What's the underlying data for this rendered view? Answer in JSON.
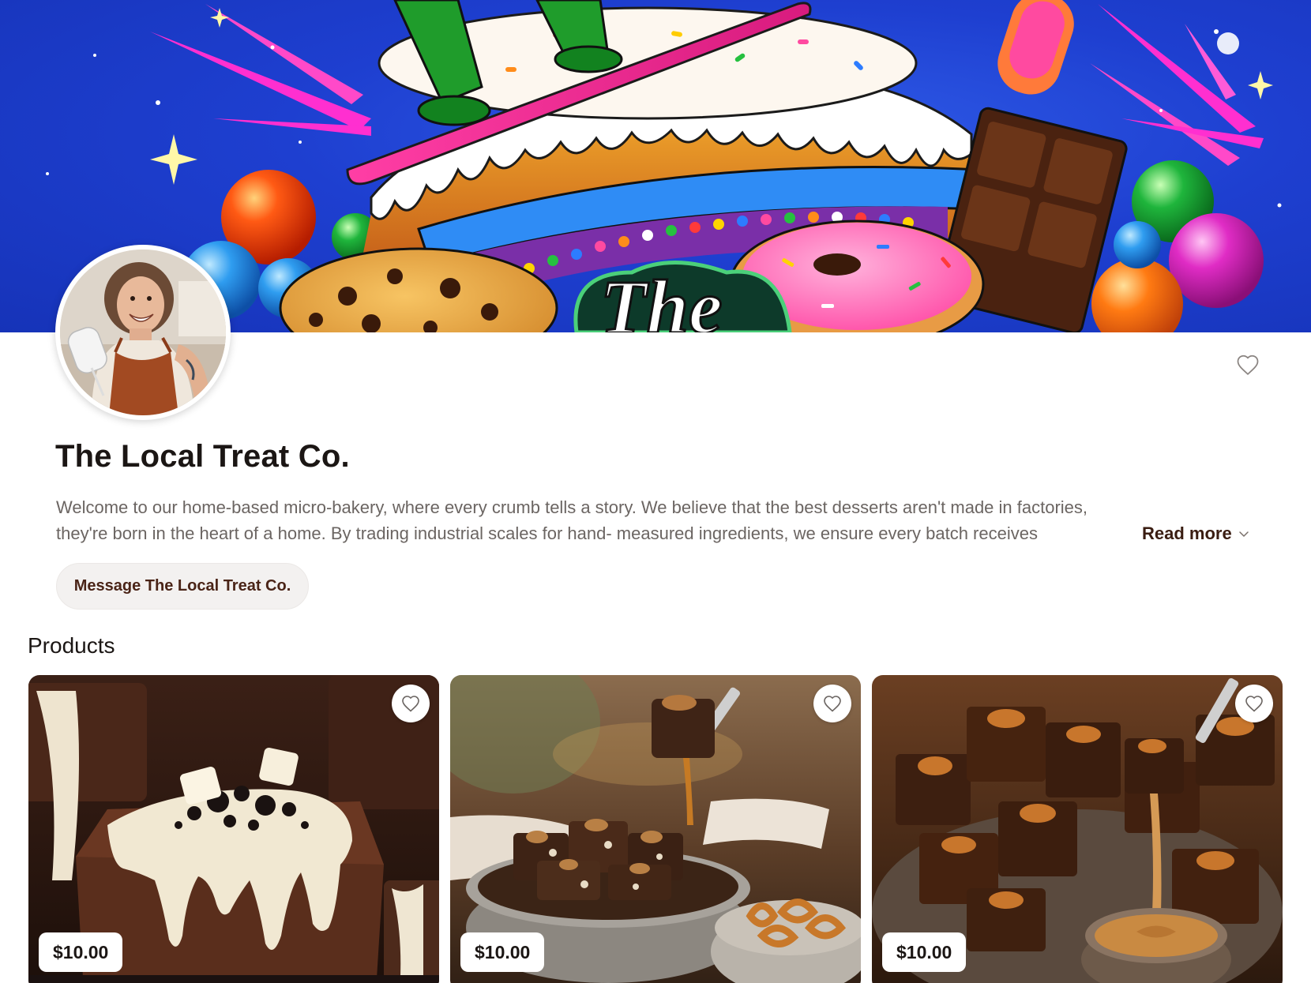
{
  "store": {
    "name": "The Local Treat Co.",
    "description_line1": "Welcome to our home-based micro-bakery, where every crumb tells a story. We believe that the best desserts aren't made in factories,",
    "description_line2": "they're born in the heart of a home. By trading industrial scales for hand- measured ingredients, we ensure every batch receives",
    "read_more_label": "Read more",
    "message_button_label": "Message The Local Treat Co."
  },
  "banner": {
    "logo_text": "The"
  },
  "products": {
    "heading": "Products",
    "items": [
      {
        "price": "$10.00",
        "image": "cookies-and-cream brownie with white chocolate drizzle"
      },
      {
        "price": "$10.00",
        "image": "pecan caramel pretzel brownie bites"
      },
      {
        "price": "$10.00",
        "image": "biscoff cookie butter brownie squares"
      }
    ]
  },
  "icons": {
    "store_favorite": "heart-outline-icon",
    "card_favorite": "heart-outline-icon",
    "read_more_chevron": "chevron-down-icon"
  },
  "colors": {
    "brand_dark": "#3a1d12",
    "button_bg": "#f3f1f0",
    "text_muted": "#6b6562",
    "banner_blue": "#1e3fd0"
  }
}
